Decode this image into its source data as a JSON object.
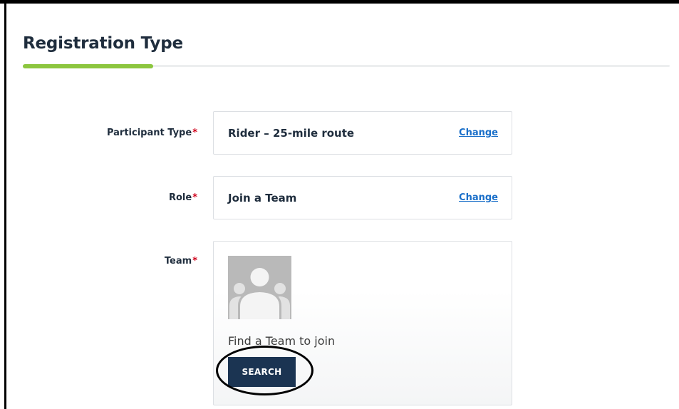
{
  "page": {
    "title": "Registration Type",
    "progress_fraction": 0.2,
    "colors": {
      "progress_fill": "#8cc63f",
      "progress_track": "#eceeef",
      "link": "#1a6fc9",
      "button": "#1b3452",
      "required": "#d0021b"
    }
  },
  "fields": {
    "participant_type": {
      "label": "Participant Type",
      "required_mark": "*",
      "value": "Rider – 25-mile route",
      "change_label": "Change"
    },
    "role": {
      "label": "Role",
      "required_mark": "*",
      "value": "Join a Team",
      "change_label": "Change"
    },
    "team": {
      "label": "Team",
      "required_mark": "*",
      "placeholder_icon": "team-silhouette-icon",
      "prompt": "Find a Team to join",
      "search_label": "SEARCH"
    }
  }
}
